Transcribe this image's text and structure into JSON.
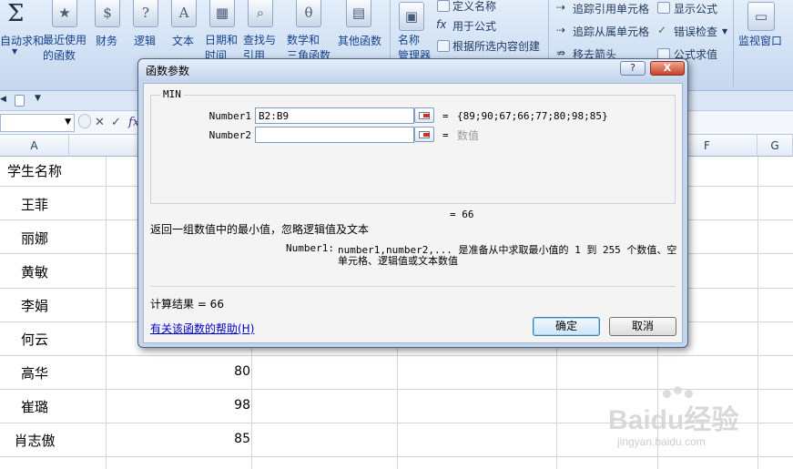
{
  "ribbon": {
    "autosum_label": "自动求和",
    "recent_label": "最近使用\n的函数",
    "finance_label": "财务",
    "logic_label": "逻辑",
    "text_label": "文本",
    "datetime_label": "日期和\n时间",
    "lookup_label": "查找与\n引用",
    "math_label": "数学和\n三角函数",
    "other_label": "其他函数",
    "name_mgr_label": "名称\n管理器",
    "define_name": "定义名称",
    "use_in_formula": "用于公式",
    "create_from_sel": "根据所选内容创建",
    "trace_precedents": "追踪引用单元格",
    "trace_dependents": "追踪从属单元格",
    "remove_arrows": "移去箭头",
    "show_formulas": "显示公式",
    "error_check": "错误检查",
    "evaluate": "公式求值",
    "watch_window": "监视窗口",
    "sigma": "Σ"
  },
  "formula_bar": {
    "name_box": "",
    "fx": "fx"
  },
  "sheet": {
    "columns": [
      "A",
      "F",
      "G"
    ],
    "header_a": "学生名称",
    "names": [
      "王菲",
      "丽娜",
      "黄敏",
      "李娟",
      "何云",
      "高华",
      "崔璐",
      "肖志傲"
    ],
    "scores": [
      "",
      "",
      "",
      "",
      "",
      "80",
      "98",
      "85"
    ]
  },
  "dialog": {
    "title": "函数参数",
    "help_btn": "?",
    "close_btn": "X",
    "function_name": "MIN",
    "arg1_label": "Number1",
    "arg1_value": "B2:B9",
    "arg1_result": "{89;90;67;66;77;80;98;85}",
    "arg2_label": "Number2",
    "arg2_value": "",
    "arg2_result": "数值",
    "eq": "=",
    "formula_result_line": "= 66",
    "description": "返回一组数值中的最小值，忽略逻辑值及文本",
    "arg_help_label": "Number1:",
    "arg_help_text_1": "number1,number2,... 是准备从中求取最小值的 1 到 255 个数值、空",
    "arg_help_text_2": "单元格、逻辑值或文本数值",
    "calc_result": "计算结果 = 66",
    "help_link": "有关该函数的帮助(H)",
    "ok": "确定",
    "cancel": "取消"
  },
  "watermark": {
    "main": "Baidu经验",
    "sub": "jingyan.baidu.com"
  }
}
